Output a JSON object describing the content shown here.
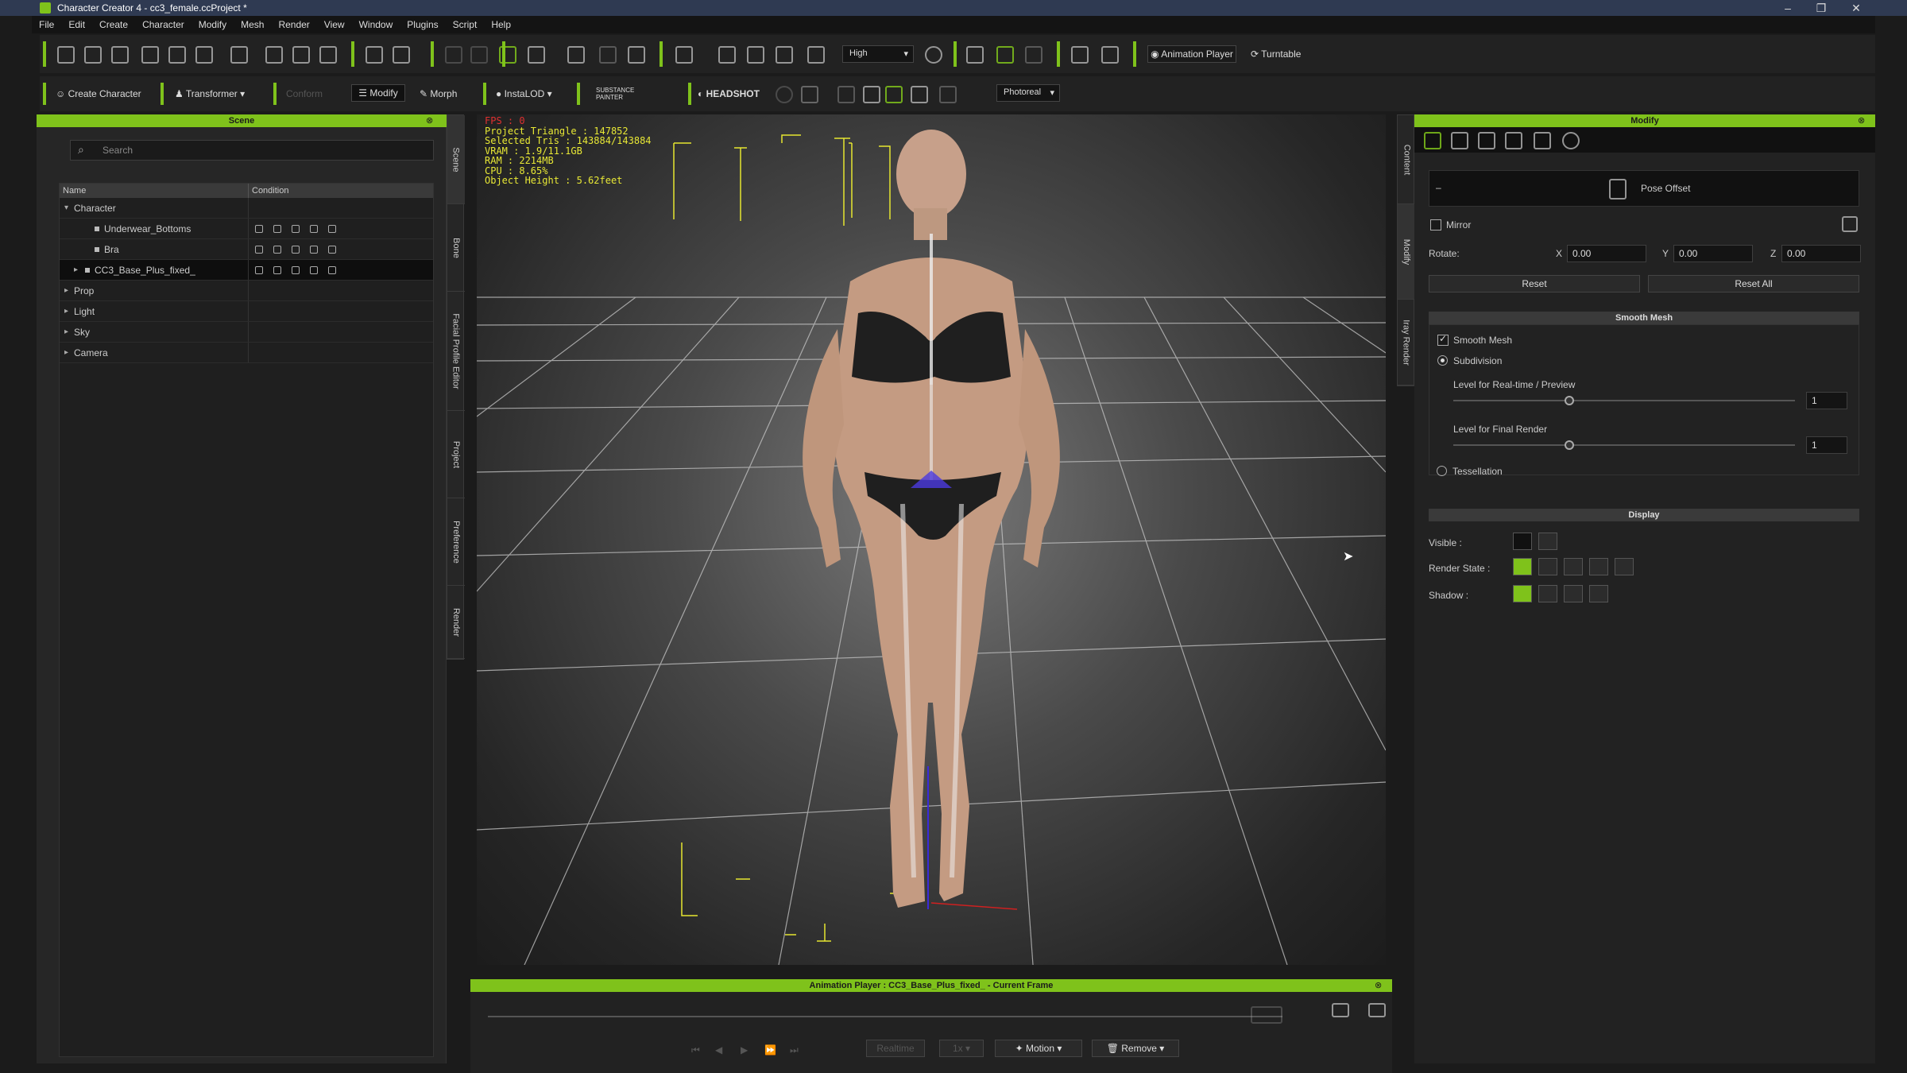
{
  "window": {
    "title": "Character Creator 4 - cc3_female.ccProject *",
    "min": "–",
    "max": "❐",
    "close": "✕"
  },
  "menu": [
    "File",
    "Edit",
    "Create",
    "Character",
    "Modify",
    "Mesh",
    "Render",
    "View",
    "Window",
    "Plugins",
    "Script",
    "Help"
  ],
  "toolbar1": {
    "quality": "High",
    "animation_player": "Animation Player",
    "turntable": "Turntable"
  },
  "toolbar2": {
    "create_character": "Create Character",
    "transformer": "Transformer",
    "conform": "Conform",
    "modify": "Modify",
    "morph": "Morph",
    "instalod": "InstaLOD",
    "substance": "SUBSTANCE PAINTER",
    "headshot": "HEADSHOT",
    "render_mode": "Photoreal"
  },
  "scene": {
    "title": "Scene",
    "search_placeholder": "Search",
    "columns": [
      "Name",
      "Condition"
    ],
    "rows": [
      {
        "label": "Character",
        "level": 0,
        "arrow": "▾"
      },
      {
        "label": "Underwear_Bottoms",
        "level": 2,
        "arrow": ""
      },
      {
        "label": "Bra",
        "level": 2,
        "arrow": ""
      },
      {
        "label": "CC3_Base_Plus_fixed_",
        "level": 1,
        "arrow": "▸"
      },
      {
        "label": "Prop",
        "level": 0,
        "arrow": "▸"
      },
      {
        "label": "Light",
        "level": 0,
        "arrow": "▸"
      },
      {
        "label": "Sky",
        "level": 0,
        "arrow": "▸"
      },
      {
        "label": "Camera",
        "level": 0,
        "arrow": "▸"
      }
    ]
  },
  "left_tabs": [
    "Scene",
    "Bone",
    "Facial Profile Editor",
    "Project",
    "Preference",
    "Render"
  ],
  "right_tabs": [
    "Content",
    "Modify",
    "Iray Render"
  ],
  "viewport": {
    "fps": "FPS : 0",
    "stats": [
      "Project Triangle : 147852",
      "Selected Tris : 143884/143884",
      "VRAM : 1.9/11.1GB",
      "RAM : 2214MB",
      "CPU : 8.65%",
      "Object Height : 5.62feet"
    ]
  },
  "animation_player": {
    "title": "Animation Player : CC3_Base_Plus_fixed_ - Current Frame",
    "realtime": "Realtime",
    "speed": "1x",
    "motion": "Motion",
    "remove": "Remove"
  },
  "modify": {
    "title": "Modify",
    "pose_offset": "Pose Offset",
    "mirror": "Mirror",
    "rotate": "Rotate:",
    "x_label": "X",
    "x_value": "0.00",
    "y_label": "Y",
    "y_value": "0.00",
    "z_label": "Z",
    "z_value": "0.00",
    "reset": "Reset",
    "reset_all": "Reset All",
    "smooth_mesh_header": "Smooth Mesh",
    "smooth_mesh": "Smooth Mesh",
    "subdivision": "Subdivision",
    "level_realtime": "Level for Real-time / Preview",
    "level_realtime_value": "1",
    "level_final": "Level for Final Render",
    "level_final_value": "1",
    "tessellation": "Tessellation",
    "display_header": "Display",
    "visible": "Visible :",
    "render_state": "Render State :",
    "shadow": "Shadow :"
  },
  "colors": {
    "accent": "#7fc21b",
    "stats": "#e8e835",
    "fps": "#e03030"
  }
}
